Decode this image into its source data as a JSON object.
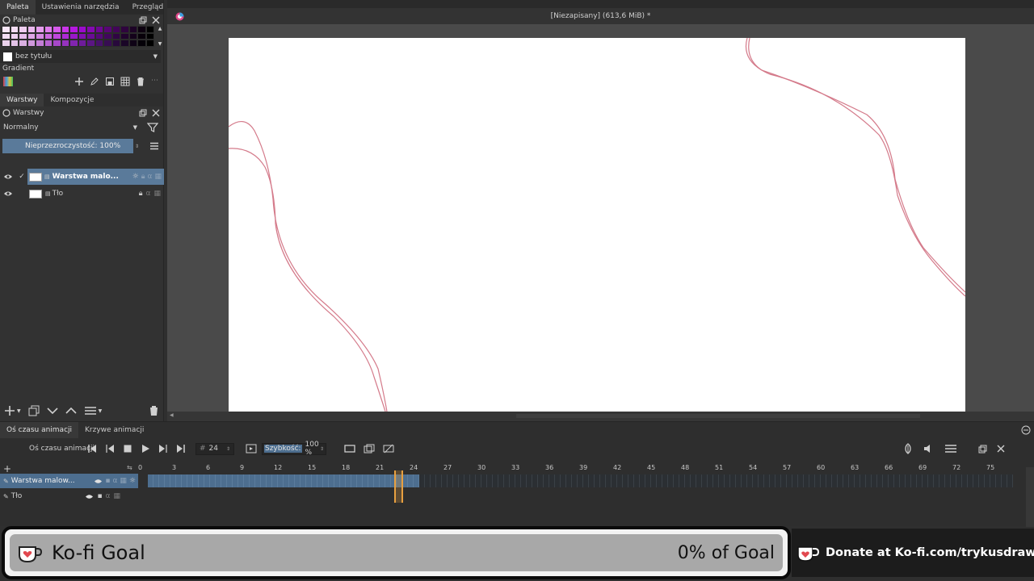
{
  "left_panel": {
    "tabs": [
      "Paleta",
      "Ustawienia narzędzia",
      "Przegląd"
    ],
    "palette": {
      "title": "Paleta",
      "swatch_colors": [
        [
          "#f7e6f7",
          "#f4dcf4",
          "#efcdf0",
          "#eab8ee",
          "#e59ded",
          "#df7cec",
          "#d65aeb",
          "#c935e8",
          "#b418e0",
          "#9b0ccc",
          "#840ab0",
          "#6d0892",
          "#570674",
          "#420558",
          "#2f043e",
          "#1d0326",
          "#0d0110",
          "#000000"
        ],
        [
          "#f2ddf3",
          "#edd0ef",
          "#e6bdea",
          "#dfa6e6",
          "#d68ae3",
          "#cb68df",
          "#bf48dc",
          "#ae2ad6",
          "#9818c8",
          "#8010b0",
          "#6a0c95",
          "#550979",
          "#41075d",
          "#300544",
          "#21032e",
          "#14021b",
          "#08010a",
          "#000000"
        ],
        [
          "#ead2ec",
          "#e3c3e7",
          "#dab0e2",
          "#cf98dc",
          "#c37ed6",
          "#b662d0",
          "#a748c9",
          "#9633bf",
          "#8225b0",
          "#6e1c9b",
          "#5b1684",
          "#48116b",
          "#370d52",
          "#28093c",
          "#1a0627",
          "#0f0316",
          "#050108",
          "#000000"
        ]
      ],
      "palette_name": "bez tytułu",
      "gradient_label": "Gradient"
    },
    "layers_tabs": [
      "Warstwy",
      "Kompozycje"
    ],
    "layers": {
      "title": "Warstwy",
      "blend_mode": "Normalny",
      "opacity_label": "Nieprzezroczystość:  100%",
      "items": [
        {
          "name": "Warstwa malo..."
        },
        {
          "name": "Tło"
        }
      ]
    }
  },
  "document": {
    "title": "[Niezapisany]  (613,6 MiB) *"
  },
  "timeline": {
    "tabs": [
      "Oś czasu animacji",
      "Krzywe animacji"
    ],
    "panel_label": "Oś czasu animacji",
    "current_frame": "24",
    "speed_label": "Szybkość:",
    "speed_value": "100 %",
    "ticks": [
      "0",
      "3",
      "6",
      "9",
      "12",
      "15",
      "18",
      "21",
      "24",
      "27",
      "30",
      "33",
      "36",
      "39",
      "42",
      "45",
      "48",
      "51",
      "54",
      "57",
      "60",
      "63",
      "66",
      "69",
      "72",
      "75"
    ],
    "layers": [
      {
        "name": "Warstwa malow..."
      },
      {
        "name": "Tło"
      }
    ],
    "filled_frames": 24,
    "selected_frame": 24
  },
  "kofi": {
    "title": "Ko-fi Goal",
    "progress_label": "0% of Goal",
    "progress_fraction": 0,
    "donate_text": "Donate at Ko-fi.com/trykusdraw"
  }
}
